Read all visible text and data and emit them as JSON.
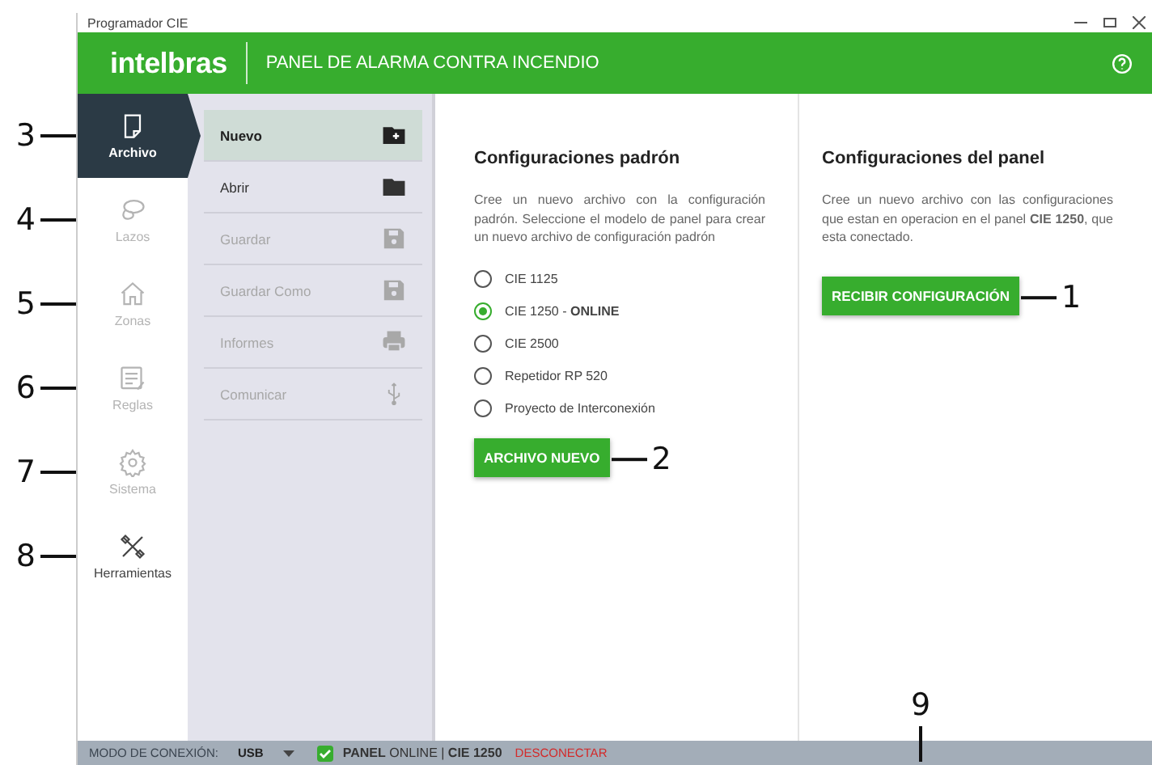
{
  "window": {
    "title": "Programador CIE"
  },
  "header": {
    "logo": "intelbras",
    "title": "PANEL DE ALARMA CONTRA INCENDIO"
  },
  "nav": [
    {
      "label": "Archivo",
      "selected": true,
      "disabled": false,
      "callout": "3"
    },
    {
      "label": "Lazos",
      "selected": false,
      "disabled": true,
      "callout": "4"
    },
    {
      "label": "Zonas",
      "selected": false,
      "disabled": true,
      "callout": "5"
    },
    {
      "label": "Reglas",
      "selected": false,
      "disabled": true,
      "callout": "6"
    },
    {
      "label": "Sistema",
      "selected": false,
      "disabled": true,
      "callout": "7"
    },
    {
      "label": "Herramientas",
      "selected": false,
      "disabled": false,
      "callout": "8"
    }
  ],
  "menu": [
    {
      "label": "Nuevo",
      "selected": true,
      "disabled": false
    },
    {
      "label": "Abrir",
      "selected": false,
      "disabled": false
    },
    {
      "label": "Guardar",
      "selected": false,
      "disabled": true
    },
    {
      "label": "Guardar Como",
      "selected": false,
      "disabled": true
    },
    {
      "label": "Informes",
      "selected": false,
      "disabled": true
    },
    {
      "label": "Comunicar",
      "selected": false,
      "disabled": true
    }
  ],
  "default_config": {
    "title": "Configuraciones padrón",
    "description": "Cree un nuevo archivo con la configuración padrón. Seleccione el modelo de panel para crear un nuevo archivo de configuración padrón",
    "options": [
      {
        "label": "CIE 1125",
        "selected": false
      },
      {
        "label": "CIE 1250 - **ONLINE**",
        "selected": true
      },
      {
        "label": "CIE 2500",
        "selected": false
      },
      {
        "label": "Repetidor RP 520",
        "selected": false
      },
      {
        "label": "Proyecto de Interconexión",
        "selected": false
      }
    ],
    "button": "ARCHIVO NUEVO",
    "callout": "2"
  },
  "panel_config": {
    "title": "Configuraciones del panel",
    "description": "Cree un nuevo archivo con las configuraciones que estan en operacion en el panel **CIE 1250**, que esta conectado.",
    "button": "RECIBIR CONFIGURACIÓN",
    "callout": "1"
  },
  "status_bar": {
    "mode_label": "MODO DE CONEXIÓN:",
    "mode_value": "USB",
    "connected": true,
    "panel": "**PANEL** ONLINE | **CIE 1250**",
    "disconnect": "DESCONECTAR",
    "callout": "9"
  }
}
